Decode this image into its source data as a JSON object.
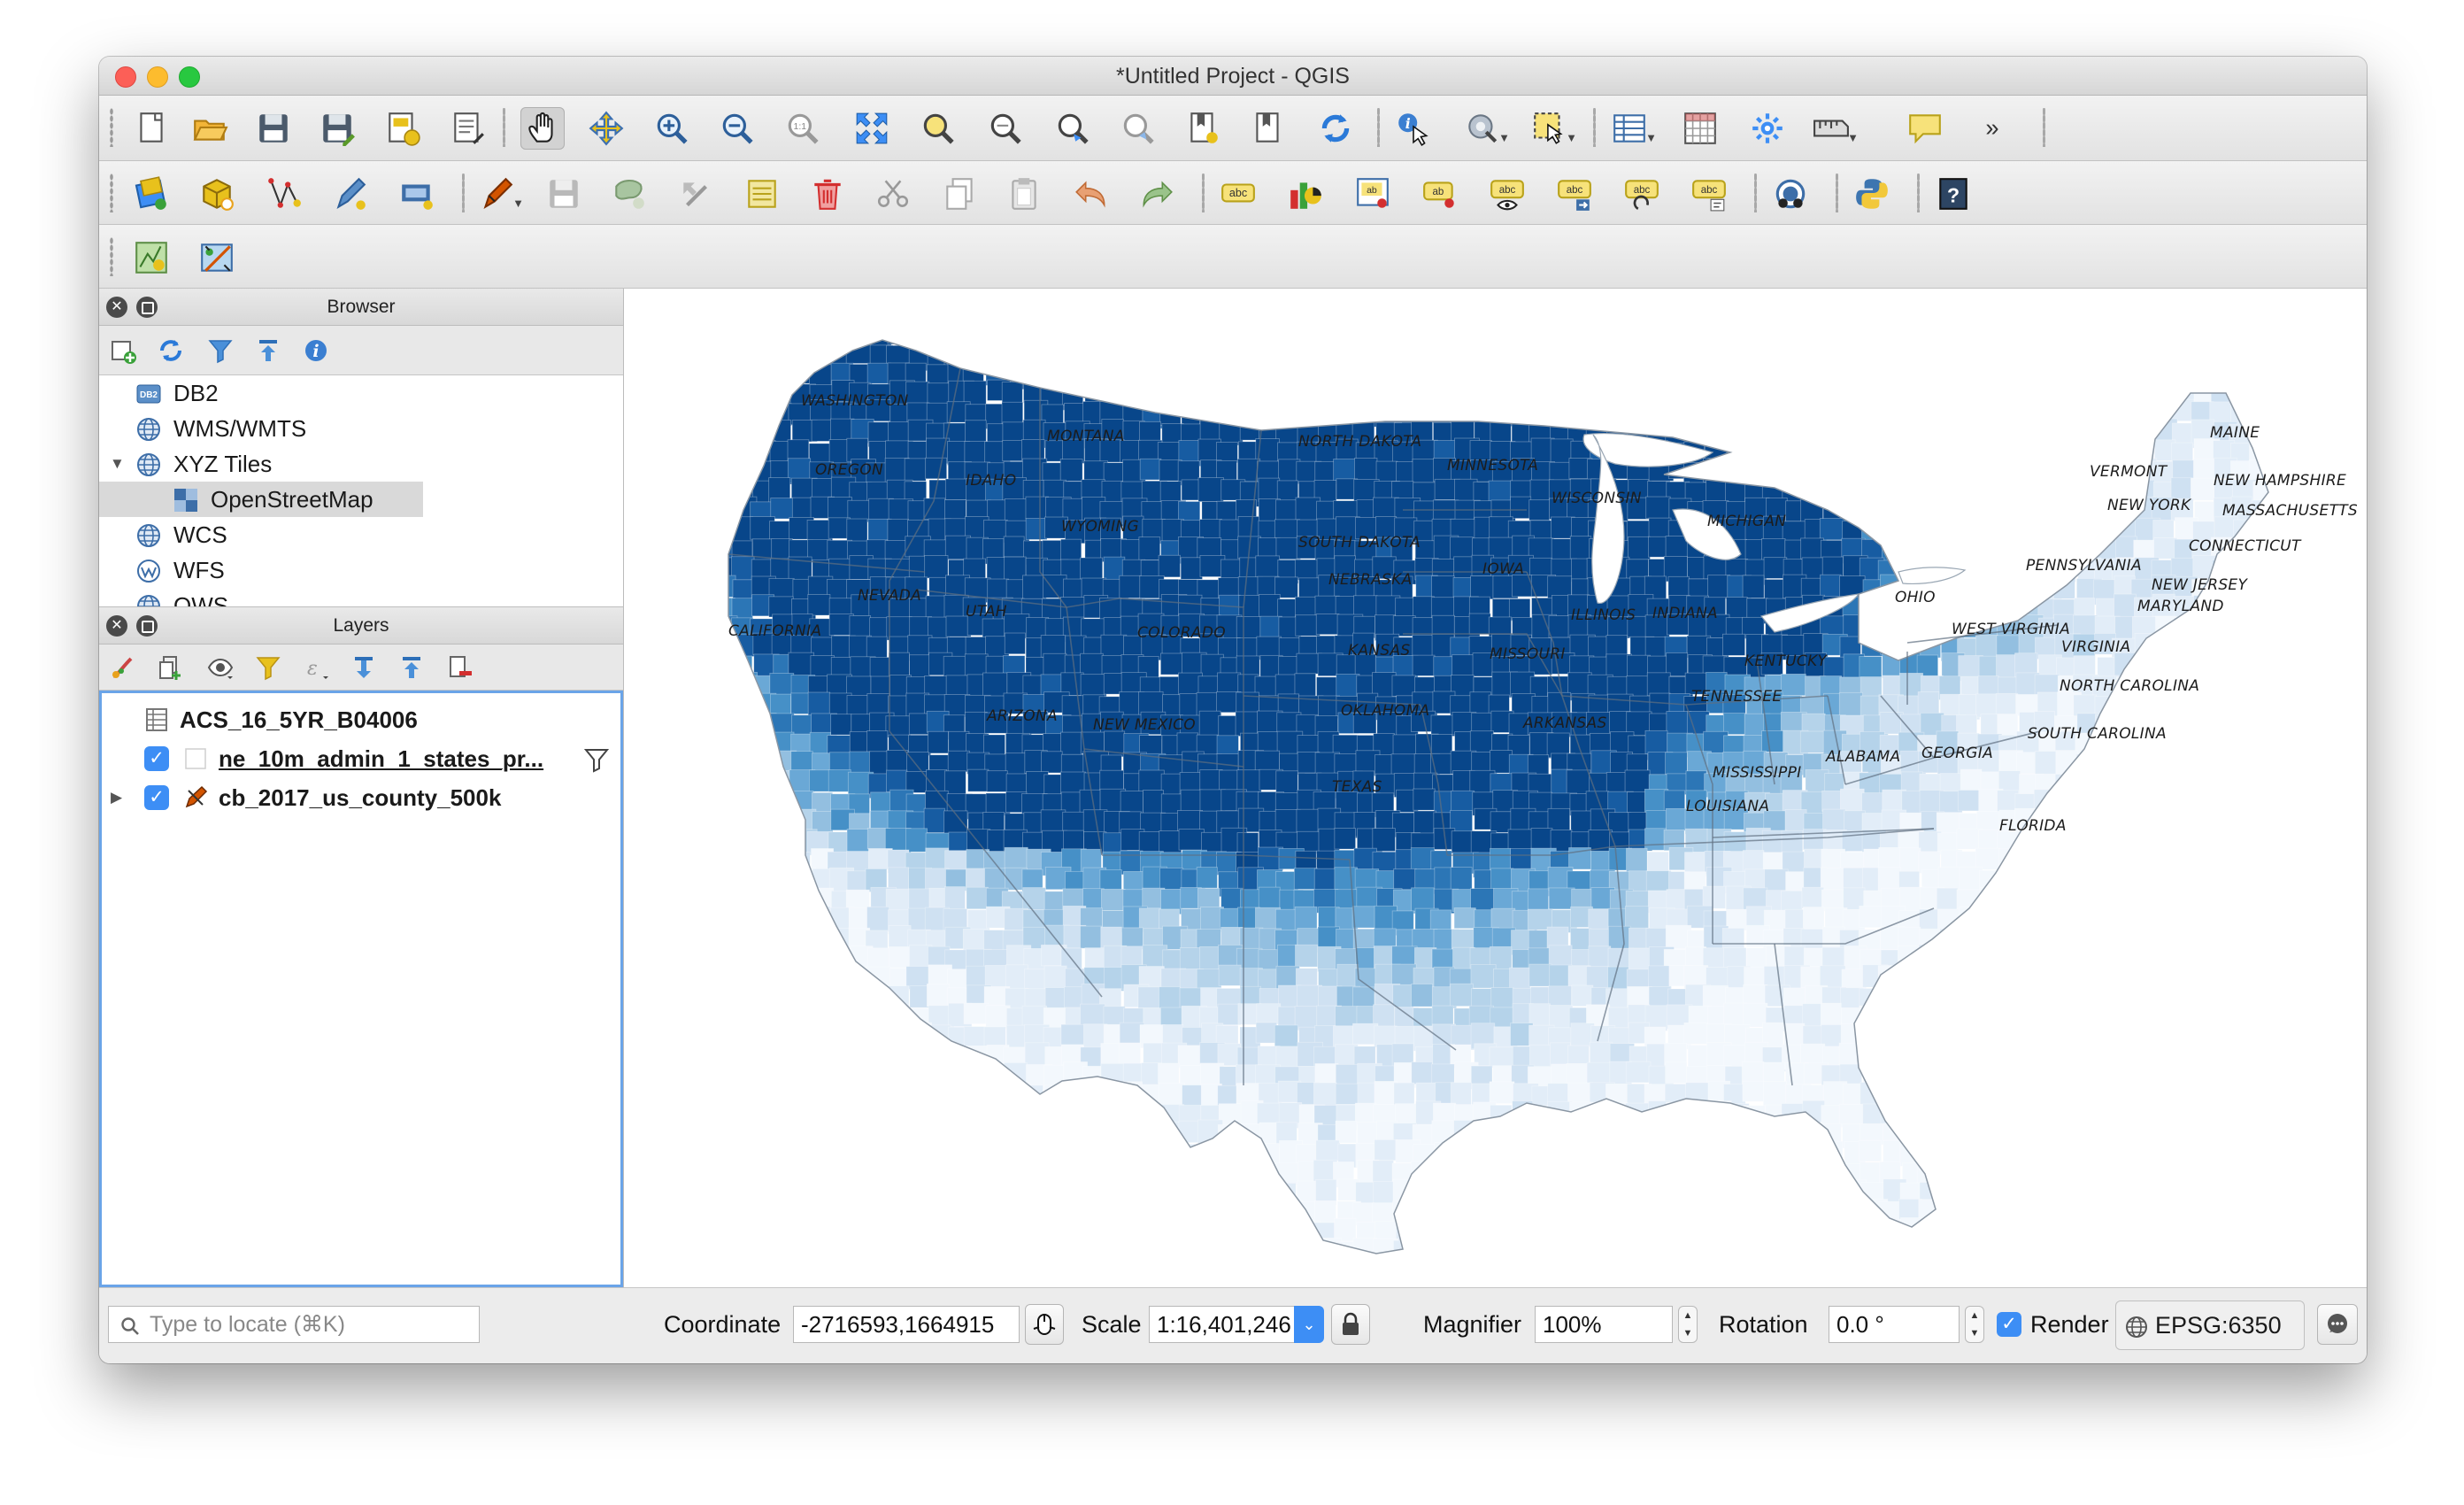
{
  "window": {
    "title": "*Untitled Project - QGIS"
  },
  "colors": {
    "accent": "#3d8ef5",
    "choropleth_light": "#eef4fb",
    "choropleth_dark": "#08306b",
    "selection_border": "#6aa4e8"
  },
  "toolbars": {
    "project_and_navigation": [
      "new-project-icon",
      "open-project-icon",
      "save-project-icon",
      "save-project-as-icon",
      "new-print-layout-icon",
      "layout-manager-icon",
      "pan-map-icon",
      "pan-to-selection-icon",
      "zoom-in-icon",
      "zoom-out-icon",
      "zoom-actual-size-icon",
      "zoom-full-icon",
      "zoom-to-selection-icon",
      "zoom-to-layer-icon",
      "zoom-last-icon",
      "zoom-next-icon",
      "new-bookmark-icon",
      "show-bookmarks-icon",
      "refresh-icon",
      "identify-features-icon",
      "run-feature-action-icon",
      "select-features-icon",
      "open-attribute-table-icon",
      "field-calculator-icon",
      "statistics-icon",
      "measure-icon",
      "map-tips-icon",
      "overflow-menu-icon"
    ],
    "digitizing_and_labels": [
      "data-source-manager-icon",
      "new-geopackage-layer-icon",
      "vertex-tool-icon",
      "digitize-icon",
      "current-edits-icon",
      "toggle-editing-icon",
      "save-layer-edits-icon",
      "add-feature-icon",
      "move-feature-icon",
      "vertex-editor-icon",
      "delete-selected-icon",
      "cut-features-icon",
      "copy-features-icon",
      "paste-features-icon",
      "undo-icon",
      "redo-icon",
      "layer-labeling-icon",
      "diagram-options-icon",
      "highlight-pinned-labels-icon",
      "pin-labels-icon",
      "show-hide-labels-icon",
      "move-label-icon",
      "rotate-label-icon",
      "change-label-icon",
      "gps-icon",
      "python-console-icon",
      "whats-this-icon"
    ],
    "plugins": [
      "geometry-plugin-icon",
      "georeferencer-icon"
    ]
  },
  "browser": {
    "title": "Browser",
    "items": [
      {
        "label": "DB2",
        "icon": "db2-icon",
        "indent": 1,
        "twisty": ""
      },
      {
        "label": "WMS/WMTS",
        "icon": "globe-icon",
        "indent": 1,
        "twisty": ""
      },
      {
        "label": "XYZ Tiles",
        "icon": "globe-icon",
        "indent": 1,
        "twisty": "▼"
      },
      {
        "label": "OpenStreetMap",
        "icon": "tiles-icon",
        "indent": 2,
        "twisty": "",
        "selected": true
      },
      {
        "label": "WCS",
        "icon": "globe-icon",
        "indent": 1,
        "twisty": ""
      },
      {
        "label": "WFS",
        "icon": "wfs-icon",
        "indent": 1,
        "twisty": ""
      },
      {
        "label": "OWS",
        "icon": "globe-icon",
        "indent": 1,
        "twisty": ""
      }
    ]
  },
  "layers": {
    "title": "Layers",
    "items": [
      {
        "label": "ACS_16_5YR_B04006",
        "checked": null,
        "icon": "table-icon",
        "twisty": ""
      },
      {
        "label": "ne_10m_admin_1_states_pr...",
        "checked": true,
        "icon": "polygon-layer-icon",
        "twisty": "",
        "filter": true
      },
      {
        "label": "cb_2017_us_county_500k",
        "checked": true,
        "icon": "edit-layer-icon",
        "twisty": "▶"
      }
    ]
  },
  "map": {
    "state_labels": [
      "WASHINGTON",
      "MONTANA",
      "NORTH DAKOTA",
      "MAINE",
      "OREGON",
      "IDAHO",
      "MINNESOTA",
      "VERMONT",
      "NEW HAMPSHIRE",
      "SOUTH DAKOTA",
      "WISCONSIN",
      "NEW YORK",
      "MASSACHUSETTS",
      "WYOMING",
      "MICHIGAN",
      "CONNECTICUT",
      "IOWA",
      "PENNSYLVANIA",
      "NEBRASKA",
      "NEW JERSEY",
      "NEVADA",
      "OHIO",
      "UTAH",
      "ILLINOIS",
      "INDIANA",
      "MARYLAND",
      "CALIFORNIA",
      "COLORADO",
      "WEST VIRGINIA",
      "KANSAS",
      "MISSOURI",
      "VIRGINIA",
      "KENTUCKY",
      "NORTH CAROLINA",
      "TENNESSEE",
      "OKLAHOMA",
      "ARIZONA",
      "NEW MEXICO",
      "ARKANSAS",
      "SOUTH CAROLINA",
      "GEORGIA",
      "ALABAMA",
      "MISSISSIPPI",
      "TEXAS",
      "LOUISIANA",
      "FLORIDA"
    ]
  },
  "status": {
    "locate_placeholder": "Type to locate (⌘K)",
    "coordinate_label": "Coordinate",
    "coordinate_value": "-2716593,1664915",
    "scale_label": "Scale",
    "scale_value": "1:16,401,246",
    "magnifier_label": "Magnifier",
    "magnifier_value": "100%",
    "rotation_label": "Rotation",
    "rotation_value": "0.0 °",
    "render_label": "Render",
    "render_checked": true,
    "crs": "EPSG:6350"
  }
}
